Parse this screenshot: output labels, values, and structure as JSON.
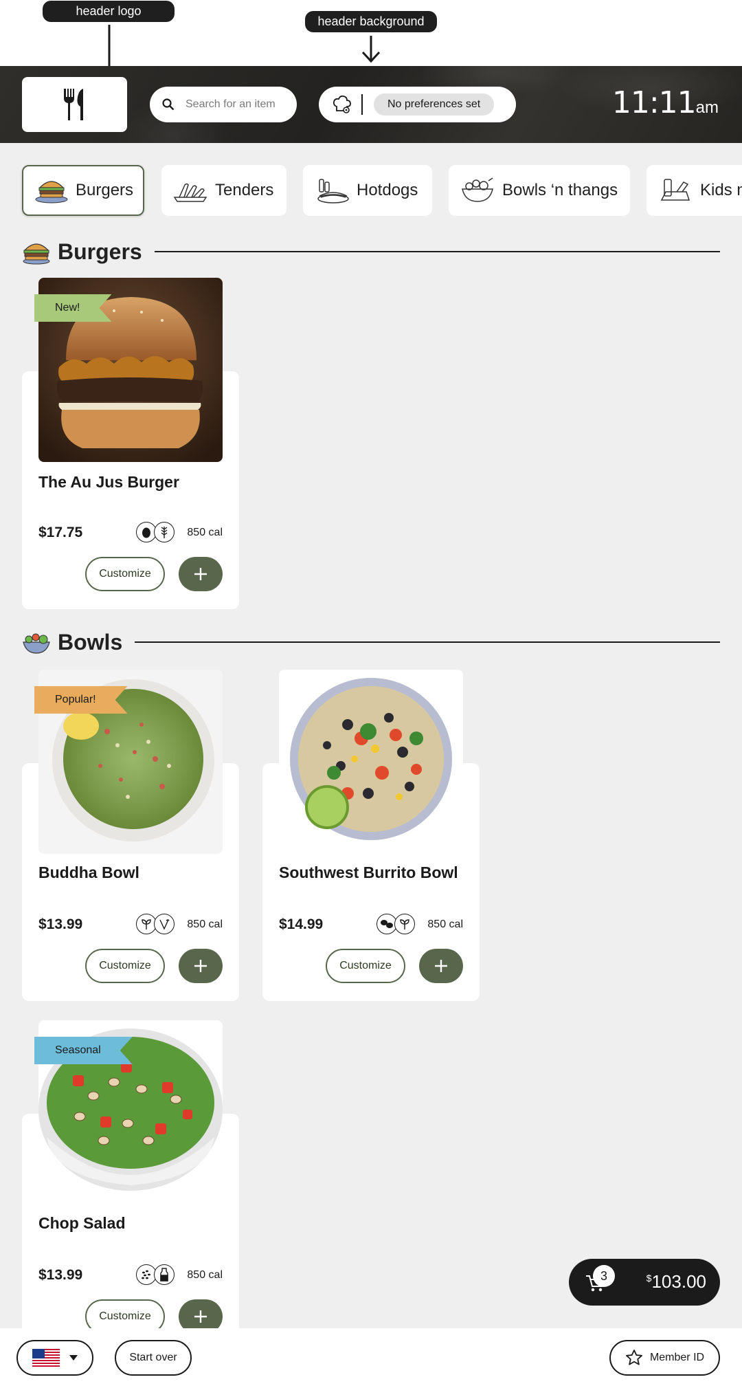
{
  "annotations": {
    "logo_label": "header logo",
    "background_label": "header background"
  },
  "header": {
    "search_placeholder": "Search for an item",
    "preferences": "No preferences set",
    "time": "11:11",
    "ampm": "am"
  },
  "categories": [
    {
      "label": "Burgers",
      "icon": "burger-icon",
      "active": true
    },
    {
      "label": "Tenders",
      "icon": "tenders-icon",
      "active": false
    },
    {
      "label": "Hotdogs",
      "icon": "hotdog-icon",
      "active": false
    },
    {
      "label": "Bowls ‘n thangs",
      "icon": "bowl-icon",
      "active": false
    },
    {
      "label": "Kids m",
      "icon": "kids-meal-icon",
      "active": false
    }
  ],
  "sections": [
    {
      "title": "Burgers",
      "icon": "burger-icon",
      "items": [
        {
          "name": "The Au Jus Burger",
          "price": "$17.75",
          "calories": "850 cal",
          "badge": "New!",
          "badge_color": "#a8c97a",
          "diet_icons": [
            "egg-icon",
            "wheat-icon"
          ],
          "customize": "Customize"
        }
      ]
    },
    {
      "title": "Bowls",
      "icon": "bowl-icon",
      "items": [
        {
          "name": "Buddha Bowl",
          "price": "$13.99",
          "calories": "850 cal",
          "badge": "Popular!",
          "badge_color": "#e8ac5c",
          "diet_icons": [
            "vegetarian-icon",
            "vegan-icon"
          ],
          "customize": "Customize"
        },
        {
          "name": "Southwest Burrito Bowl",
          "price": "$14.99",
          "calories": "850 cal",
          "badge": "",
          "badge_color": "",
          "diet_icons": [
            "beans-icon",
            "vegetarian-icon"
          ],
          "customize": "Customize"
        },
        {
          "name": "Chop Salad",
          "price": "$13.99",
          "calories": "850 cal",
          "badge": "Seasonal",
          "badge_color": "#6dbcd9",
          "diet_icons": [
            "sesame-icon",
            "dairy-icon"
          ],
          "customize": "Customize"
        }
      ]
    }
  ],
  "cart": {
    "count": "3",
    "currency": "$",
    "total": "103.00"
  },
  "footer": {
    "language_icon": "us-flag-icon",
    "start_over": "Start over",
    "member_id": "Member ID"
  },
  "colors": {
    "accent": "#58664c",
    "dark": "#1b1b1b",
    "background": "#efefef"
  }
}
